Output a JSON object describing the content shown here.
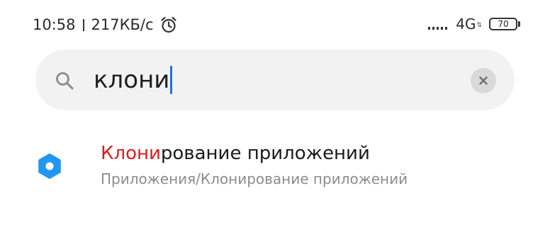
{
  "status_bar": {
    "time": "10:58",
    "speed": "217КБ/с",
    "network_type": "4G",
    "battery_level": "70",
    "icons": [
      "alarm-icon",
      "signal-icon",
      "data-arrows-icon",
      "battery-icon"
    ]
  },
  "search": {
    "value": "клони",
    "icon": "search-icon",
    "clear_icon": "close-icon"
  },
  "results": [
    {
      "title_match": "Клони",
      "title_rest": "рование приложений",
      "subtitle": "Приложения/Клонирование приложений",
      "icon": "gear-icon"
    }
  ],
  "colors": {
    "highlight": "#e21b1b",
    "caret": "#1a73e8",
    "icon_blue": "#2196f3",
    "search_bg": "#f2f2f2"
  }
}
